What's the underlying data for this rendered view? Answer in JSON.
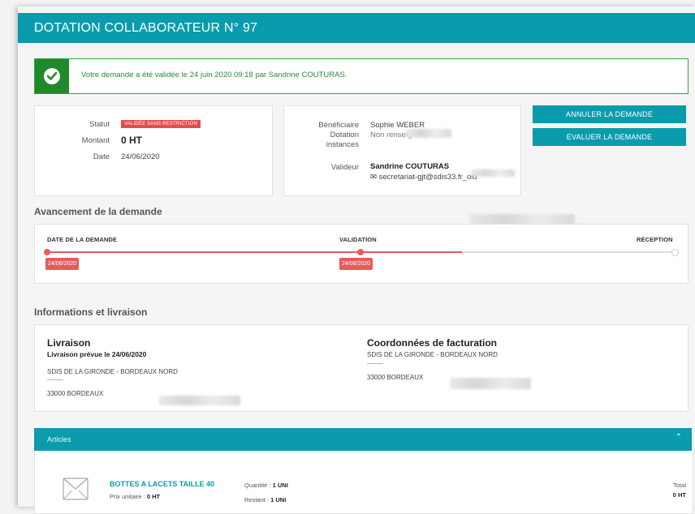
{
  "header": {
    "title": "DOTATION COLLABORATEUR N° 97"
  },
  "alert": {
    "message": "Votre demande a été validée le 24 juin 2020 09:18 par Sandrine COUTURAS."
  },
  "summary": {
    "statut_label": "Statut",
    "statut_value": "VALIDÉE SANS RESTRICTION",
    "montant_label": "Montant",
    "montant_value": "0 HT",
    "date_label": "Date",
    "date_value": "24/06/2020"
  },
  "people": {
    "beneficiaire_label": "Bénéficiaire",
    "beneficiaire_value": "Sophie WEBER",
    "dotation_label_1": "Dotation",
    "dotation_label_2": "instances",
    "dotation_value": "Non renseig",
    "valideur_label": "Valideur",
    "valideur_name": "Sandrine COUTURAS",
    "valideur_email": "secretariat-gjt@sdis33.fr_old"
  },
  "actions": {
    "cancel_label": "ANNULER LA DEMANDE",
    "evaluate_label": "EVALUER LA DEMANDE"
  },
  "progress": {
    "title": "Avancement de la demande",
    "steps": [
      {
        "label": "DATE DE LA DEMANDE",
        "date": "24/06/2020"
      },
      {
        "label": "VALIDATION",
        "date": "24/06/2020"
      },
      {
        "label": "RÉCEPTION"
      }
    ]
  },
  "info": {
    "title": "Informations et livraison",
    "livraison": {
      "title": "Livraison",
      "subtitle": "Livraison prévue le 24/06/2020",
      "line1": "SDIS DE LA GIRONDE - BORDEAUX NORD",
      "separator": "----------",
      "line3": "33000 BORDEAUX"
    },
    "facturation": {
      "title": "Coordonnées de facturation",
      "line1": "SDIS DE LA GIRONDE - BORDEAUX NORD",
      "separator": "----------",
      "line3": "33000 BORDEAUX"
    }
  },
  "articles": {
    "bar_label": "Articles",
    "item": {
      "name": "BOTTES A LACETS TAILLE 40",
      "unit_price_label": "Prix unitaire :",
      "unit_price_value": "0 HT",
      "qty_label": "Quantité :",
      "qty_value": "1 UNI",
      "remaining_label": "Restant :",
      "remaining_value": "1 UNI",
      "total_label": "Total",
      "total_value": "0 HT"
    }
  },
  "colors": {
    "accent": "#0a9cad",
    "success": "#1f8a2c",
    "danger": "#e65b5b"
  },
  "icons": {
    "alert": "check-circle-icon",
    "email": "envelope-icon",
    "collapse": "chevron-up-icon",
    "product": "image-placeholder-icon"
  }
}
